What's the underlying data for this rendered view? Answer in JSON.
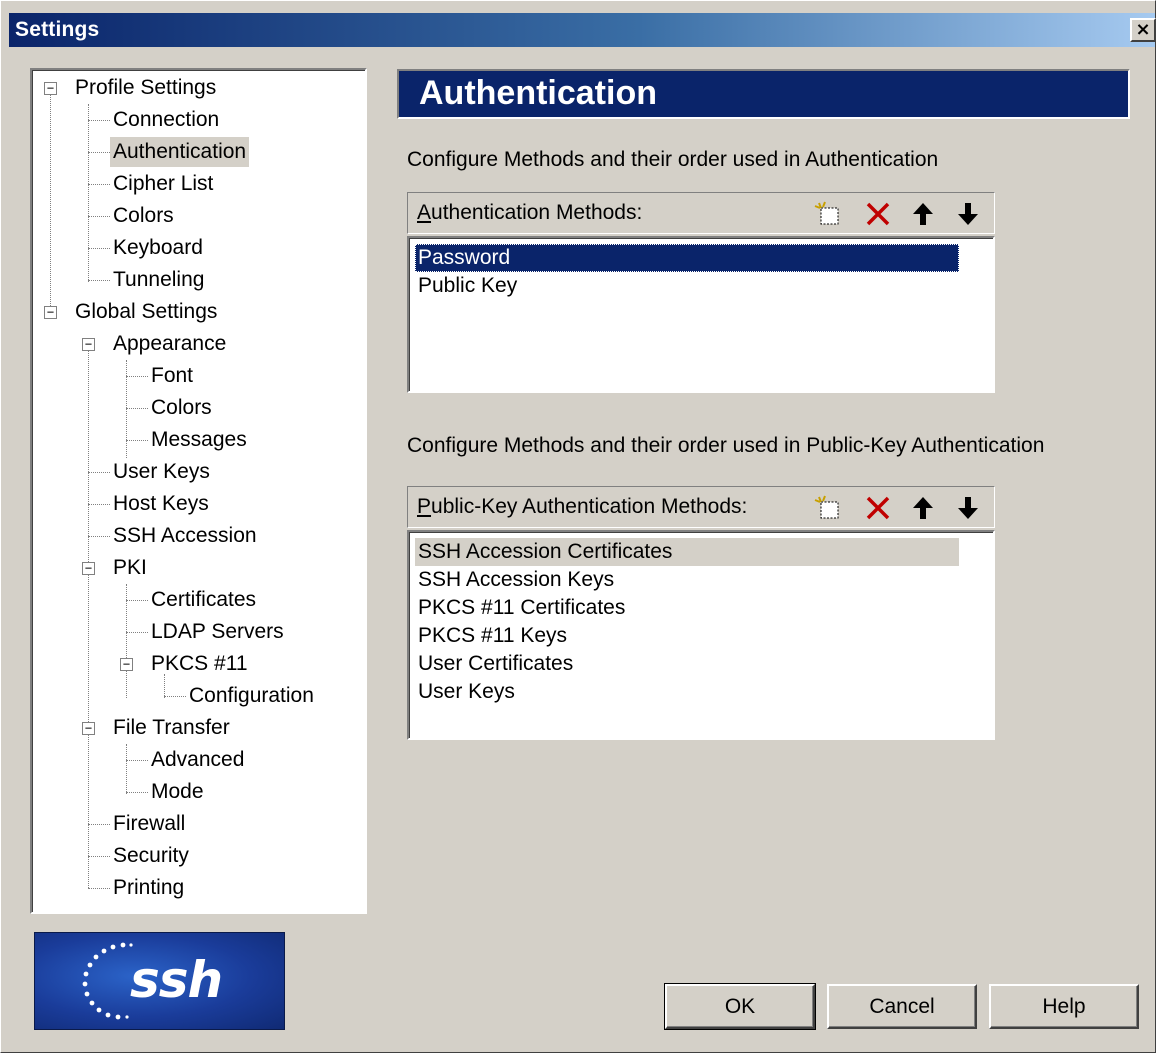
{
  "window": {
    "title": "Settings",
    "close_label": "×"
  },
  "tree": {
    "items": [
      {
        "label": "Profile Settings"
      },
      {
        "label": "Connection"
      },
      {
        "label": "Authentication"
      },
      {
        "label": "Cipher List"
      },
      {
        "label": "Colors"
      },
      {
        "label": "Keyboard"
      },
      {
        "label": "Tunneling"
      },
      {
        "label": "Global Settings"
      },
      {
        "label": "Appearance"
      },
      {
        "label": "Font"
      },
      {
        "label": "Colors"
      },
      {
        "label": "Messages"
      },
      {
        "label": "User Keys"
      },
      {
        "label": "Host Keys"
      },
      {
        "label": "SSH Accession"
      },
      {
        "label": "PKI"
      },
      {
        "label": "Certificates"
      },
      {
        "label": "LDAP Servers"
      },
      {
        "label": "PKCS #11"
      },
      {
        "label": "Configuration"
      },
      {
        "label": "File Transfer"
      },
      {
        "label": "Advanced"
      },
      {
        "label": "Mode"
      },
      {
        "label": "Firewall"
      },
      {
        "label": "Security"
      },
      {
        "label": "Printing"
      }
    ],
    "selected": "Authentication"
  },
  "logo": {
    "text": "ssh"
  },
  "panel": {
    "title": "Authentication",
    "auth_caption": "Configure Methods and their order used in Authentication",
    "auth_group": {
      "label_accel": "A",
      "label_rest": "uthentication Methods:",
      "items": [
        "Password",
        "Public Key"
      ],
      "selected": "Password"
    },
    "pk_caption": "Configure Methods and their order used in Public-Key Authentication",
    "pk_group": {
      "label_accel": "P",
      "label_rest": "ublic-Key Authentication Methods:",
      "items": [
        "SSH Accession Certificates",
        "SSH Accession Keys",
        "PKCS #11 Certificates",
        "PKCS #11 Keys",
        "User Certificates",
        "User Keys"
      ],
      "selected": "SSH Accession Certificates"
    },
    "toolbar_icons": [
      "new-item-icon",
      "delete-icon",
      "move-up-icon",
      "move-down-icon"
    ]
  },
  "buttons": {
    "ok": "OK",
    "cancel": "Cancel",
    "help": "Help"
  },
  "colors": {
    "face": "#d4d0c8",
    "selection": "#0a246a",
    "delete": "#c00000"
  }
}
